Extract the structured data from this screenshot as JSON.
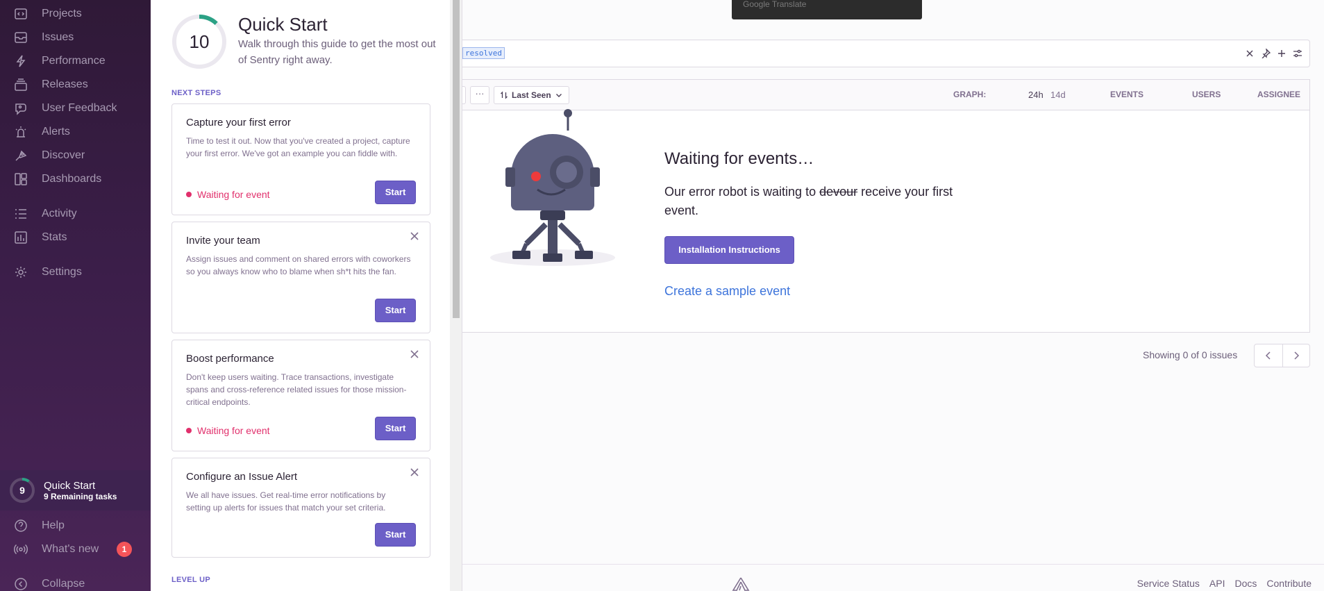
{
  "sidebar": {
    "items": [
      {
        "label": "Projects",
        "icon": "projects-icon"
      },
      {
        "label": "Issues",
        "icon": "issues-icon"
      },
      {
        "label": "Performance",
        "icon": "performance-icon"
      },
      {
        "label": "Releases",
        "icon": "releases-icon"
      },
      {
        "label": "User Feedback",
        "icon": "user-feedback-icon"
      },
      {
        "label": "Alerts",
        "icon": "alerts-icon"
      },
      {
        "label": "Discover",
        "icon": "discover-icon"
      },
      {
        "label": "Dashboards",
        "icon": "dashboards-icon"
      },
      {
        "label": "Activity",
        "icon": "activity-icon"
      },
      {
        "label": "Stats",
        "icon": "stats-icon"
      },
      {
        "label": "Settings",
        "icon": "settings-icon"
      }
    ],
    "quick_start": {
      "count": "9",
      "title": "Quick Start",
      "subtitle": "9 Remaining tasks",
      "progress": 0.1
    },
    "help_label": "Help",
    "whats_new_label": "What's new",
    "whats_new_badge": "1",
    "collapse_label": "Collapse"
  },
  "panel": {
    "progress_count": "10",
    "progress_fraction": 0.12,
    "title": "Quick Start",
    "description": "Walk through this guide to get the most out of Sentry right away.",
    "next_steps_label": "NEXT STEPS",
    "level_up_label": "LEVEL UP",
    "tasks": [
      {
        "title": "Capture your first error",
        "description": "Time to test it out. Now that you've created a project, capture your first error. We've got an example you can fiddle with.",
        "status": "Waiting for event",
        "button": "Start"
      },
      {
        "title": "Invite your team",
        "description": "Assign issues and comment on shared errors with coworkers so you always know who to blame when sh*t hits the fan.",
        "status": "",
        "button": "Start"
      },
      {
        "title": "Boost performance",
        "description": "Don't keep users waiting. Trace transactions, investigate spans and cross-reference related issues for those mission-critical endpoints.",
        "status": "Waiting for event",
        "button": "Start"
      },
      {
        "title": "Configure an Issue Alert",
        "description": "We all have issues. Get real-time error notifications by setting up alerts for issues that match your set criteria.",
        "status": "",
        "button": "Start"
      }
    ]
  },
  "translate_bar": {
    "label": "Google Translate"
  },
  "search": {
    "token": "resolved"
  },
  "results": {
    "more_label": "···",
    "sort_label": "Last Seen",
    "graph_label": "GRAPH:",
    "graph_24h": "24h",
    "graph_14d": "14d",
    "events_label": "EVENTS",
    "users_label": "USERS",
    "assignee_label": "ASSIGNEE",
    "empty_title": "Waiting for events…",
    "empty_text_before": "Our error robot is waiting to ",
    "empty_text_struck": "devour",
    "empty_text_after": " receive your first event.",
    "install_button": "Installation Instructions",
    "sample_link": "Create a sample event"
  },
  "pagination": {
    "text": "Showing 0 of 0 issues"
  },
  "footer": {
    "links": [
      "Service Status",
      "API",
      "Docs",
      "Contribute"
    ]
  },
  "colors": {
    "accent": "#6c5fc7",
    "link": "#3d74db",
    "waiting": "#e1306c",
    "badge": "#f55459"
  }
}
